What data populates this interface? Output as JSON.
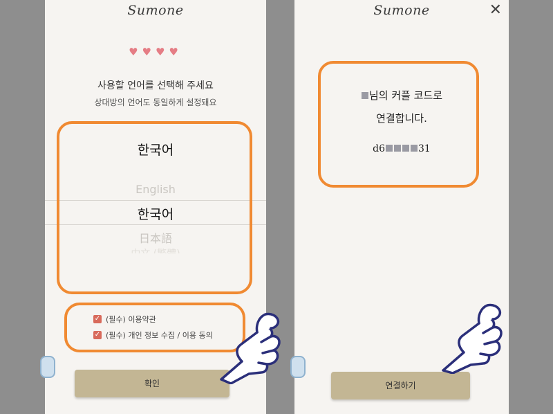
{
  "left_screen": {
    "logo": "Sumone",
    "hearts": "♥♥♥♥",
    "title": "사용할 언어를 선택해 주세요",
    "subtitle": "상대방의 언어도 동일하게 설정돼요",
    "selected_language": "한국어",
    "picker_options": [
      "English",
      "한국어",
      "日本語",
      "中文 (繁體)"
    ],
    "agreements": [
      {
        "label": "(필수) 이용약관",
        "checked": true
      },
      {
        "label": "(필수) 개인 정보 수집 / 이용 동의",
        "checked": true
      }
    ],
    "confirm_button": "확인"
  },
  "right_screen": {
    "logo": "Sumone",
    "close_symbol": "✕",
    "message_line1": "님의 커플 코드로",
    "message_line2": "연결합니다.",
    "code_prefix": "d6",
    "code_suffix": "31",
    "connect_button": "연결하기"
  },
  "colors": {
    "highlight": "#f08a32",
    "button": "#c3b694",
    "checkbox": "#d86a5b",
    "heart": "#e57d85",
    "backdrop": "#8e8e8e"
  },
  "icons": [
    "heart-icon",
    "checkbox-checked-icon",
    "close-icon",
    "pointing-hand-icon",
    "side-panel-icon"
  ]
}
